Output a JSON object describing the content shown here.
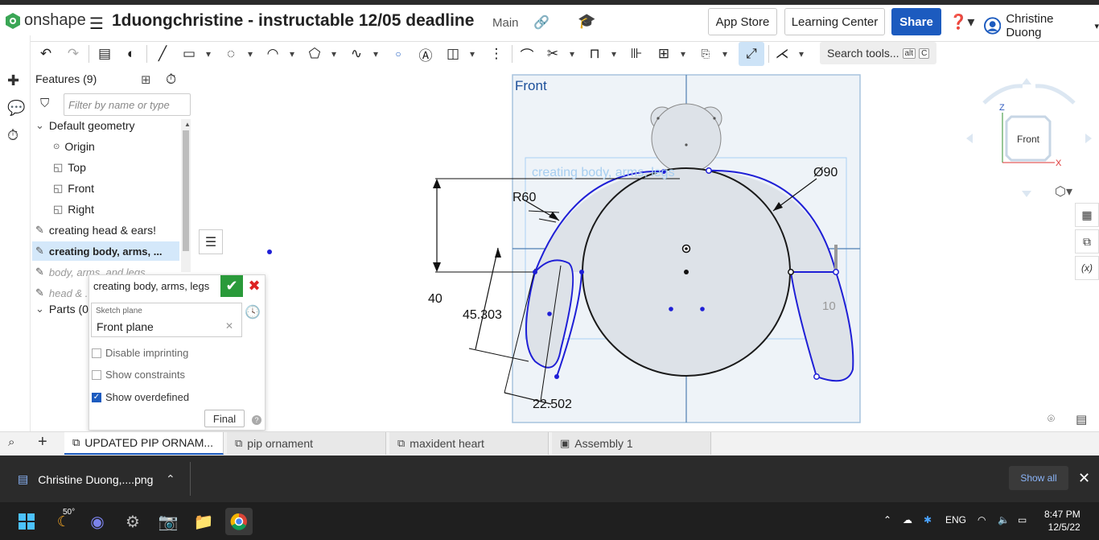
{
  "app": {
    "brand": "onshape",
    "document_title": "1duongchristine - instructable 12/05 deadline",
    "branch": "Main",
    "buttons": {
      "app_store": "App Store",
      "learning_center": "Learning Center",
      "share": "Share"
    },
    "user_name": "Christine Duong",
    "accent_color": "#1c5bbf"
  },
  "toolbar": {
    "search_tools_label": "Search tools...",
    "search_tools_shortcut_1": "alt",
    "search_tools_shortcut_2": "C"
  },
  "features": {
    "header": "Features (9)",
    "filter_placeholder": "Filter by name or type",
    "items": [
      {
        "label": "Default geometry"
      },
      {
        "label": "Origin"
      },
      {
        "label": "Top"
      },
      {
        "label": "Front"
      },
      {
        "label": "Right"
      },
      {
        "label": "creating head & ears!"
      },
      {
        "label": "creating body, arms, ..."
      },
      {
        "label": "body, arms, and legs"
      },
      {
        "label": "head & ..."
      },
      {
        "label": "Parts (0"
      }
    ]
  },
  "sketch_dialog": {
    "title": "creating body, arms, legs",
    "plane_label": "Sketch plane",
    "plane_value": "Front plane",
    "disable_imprinting": "Disable imprinting",
    "show_constraints": "Show constraints",
    "show_overdefined": "Show overdefined",
    "final_button": "Final"
  },
  "canvas": {
    "plane_label": "Front",
    "ghost_label": "creating body, arms, legs",
    "dimensions": {
      "r60": "R60",
      "d90": "Ø90",
      "d40": "40",
      "d45": "45.303",
      "d22": "22.502",
      "d10": "10"
    }
  },
  "viewcube": {
    "face": "Front",
    "axis_z": "Z",
    "axis_x": "X"
  },
  "tabs": [
    {
      "label": "UPDATED PIP ORNAM...",
      "active": true
    },
    {
      "label": "pip ornament",
      "active": false
    },
    {
      "label": "maxident heart",
      "active": false
    },
    {
      "label": "Assembly 1",
      "active": false
    }
  ],
  "download_bar": {
    "file_name": "Christine Duong,....png",
    "show_all": "Show all"
  },
  "taskbar": {
    "weather": "50°",
    "language": "ENG",
    "time": "8:47 PM",
    "date": "12/5/22"
  }
}
